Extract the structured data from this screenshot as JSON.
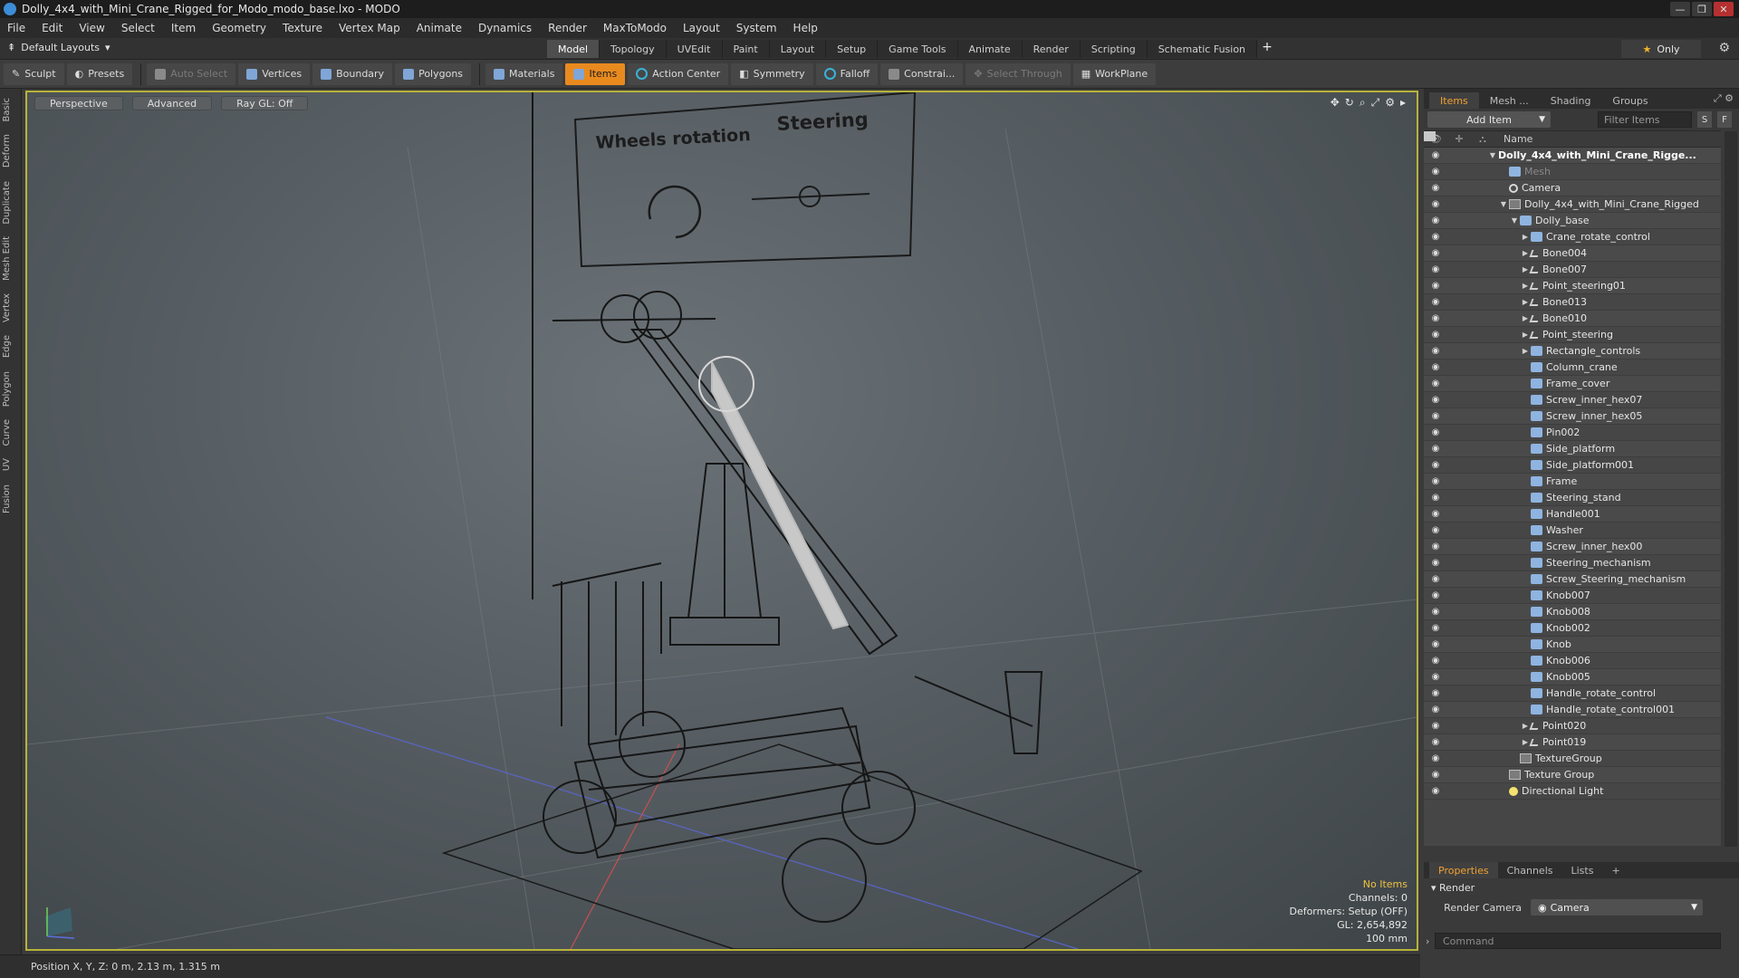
{
  "window": {
    "title": "Dolly_4x4_with_Mini_Crane_Rigged_for_Modo_modo_base.lxo - MODO",
    "buttons": [
      "—",
      "❐",
      "✕"
    ]
  },
  "menu": [
    "File",
    "Edit",
    "View",
    "Select",
    "Item",
    "Geometry",
    "Texture",
    "Vertex Map",
    "Animate",
    "Dynamics",
    "Render",
    "MaxToModo",
    "Layout",
    "System",
    "Help"
  ],
  "layouts": {
    "dropdown": "Default Layouts",
    "tabs": [
      "Model",
      "Topology",
      "UVEdit",
      "Paint",
      "Layout",
      "Setup",
      "Game Tools",
      "Animate",
      "Render",
      "Scripting",
      "Schematic Fusion"
    ],
    "active_tab": "Model",
    "plus": "+",
    "only_label": "Only"
  },
  "toolbar": {
    "sculpt": "Sculpt",
    "presets": "Presets",
    "auto_select": "Auto Select",
    "vertices": "Vertices",
    "boundary": "Boundary",
    "polygons": "Polygons",
    "materials": "Materials",
    "items": "Items",
    "action_center": "Action Center",
    "symmetry": "Symmetry",
    "falloff": "Falloff",
    "constrain": "Constrai...",
    "select_through": "Select Through",
    "workplane": "WorkPlane"
  },
  "left_tabs": [
    "Basic",
    "Deform",
    "Duplicate",
    "Mesh Edit",
    "Vertex",
    "Edge",
    "Polygon",
    "Curve",
    "UV",
    "Fusion"
  ],
  "viewport": {
    "view_mode": "Perspective",
    "shading": "Advanced",
    "raygl": "Ray GL: Off",
    "control_labels": [
      "Wheels rotation",
      "Steering"
    ],
    "info": {
      "selection": "No Items",
      "channels": "Channels: 0",
      "deformers": "Deformers: Setup (OFF)",
      "gl": "GL: 2,654,892",
      "grid": "100 mm"
    }
  },
  "items_panel": {
    "tabs": [
      "Items",
      "Mesh ...",
      "Shading",
      "Groups"
    ],
    "active_tab": "Items",
    "add_item": "Add Item",
    "filter_placeholder": "Filter Items",
    "s_btn": "S",
    "f_btn": "F",
    "column_name": "Name",
    "rows": [
      {
        "label": "Dolly_4x4_with_Mini_Crane_Rigge...",
        "icon": "scene",
        "depth": 0,
        "expander": "▼",
        "style": "bold"
      },
      {
        "label": "Mesh",
        "icon": "mesh",
        "depth": 1,
        "expander": "",
        "style": "dim"
      },
      {
        "label": "Camera",
        "icon": "cam",
        "depth": 1,
        "expander": "",
        "style": ""
      },
      {
        "label": "Dolly_4x4_with_Mini_Crane_Rigged",
        "icon": "group",
        "depth": 1,
        "expander": "▼",
        "style": ""
      },
      {
        "label": "Dolly_base",
        "icon": "mesh",
        "depth": 2,
        "expander": "▼",
        "style": ""
      },
      {
        "label": "Crane_rotate_control",
        "icon": "mesh",
        "depth": 3,
        "expander": "▶",
        "style": ""
      },
      {
        "label": "Bone004",
        "icon": "bone",
        "depth": 3,
        "expander": "▶",
        "style": ""
      },
      {
        "label": "Bone007",
        "icon": "bone",
        "depth": 3,
        "expander": "▶",
        "style": ""
      },
      {
        "label": "Point_steering01",
        "icon": "bone",
        "depth": 3,
        "expander": "▶",
        "style": ""
      },
      {
        "label": "Bone013",
        "icon": "bone",
        "depth": 3,
        "expander": "▶",
        "style": ""
      },
      {
        "label": "Bone010",
        "icon": "bone",
        "depth": 3,
        "expander": "▶",
        "style": ""
      },
      {
        "label": "Point_steering",
        "icon": "bone",
        "depth": 3,
        "expander": "▶",
        "style": ""
      },
      {
        "label": "Rectangle_controls",
        "icon": "mesh",
        "depth": 3,
        "expander": "▶",
        "style": ""
      },
      {
        "label": "Column_crane",
        "icon": "mesh",
        "depth": 3,
        "expander": "",
        "style": ""
      },
      {
        "label": "Frame_cover",
        "icon": "mesh",
        "depth": 3,
        "expander": "",
        "style": ""
      },
      {
        "label": "Screw_inner_hex07",
        "icon": "mesh",
        "depth": 3,
        "expander": "",
        "style": ""
      },
      {
        "label": "Screw_inner_hex05",
        "icon": "mesh",
        "depth": 3,
        "expander": "",
        "style": ""
      },
      {
        "label": "Pin002",
        "icon": "mesh",
        "depth": 3,
        "expander": "",
        "style": ""
      },
      {
        "label": "Side_platform",
        "icon": "mesh",
        "depth": 3,
        "expander": "",
        "style": ""
      },
      {
        "label": "Side_platform001",
        "icon": "mesh",
        "depth": 3,
        "expander": "",
        "style": ""
      },
      {
        "label": "Frame",
        "icon": "mesh",
        "depth": 3,
        "expander": "",
        "style": ""
      },
      {
        "label": "Steering_stand",
        "icon": "mesh",
        "depth": 3,
        "expander": "",
        "style": ""
      },
      {
        "label": "Handle001",
        "icon": "mesh",
        "depth": 3,
        "expander": "",
        "style": ""
      },
      {
        "label": "Washer",
        "icon": "mesh",
        "depth": 3,
        "expander": "",
        "style": ""
      },
      {
        "label": "Screw_inner_hex00",
        "icon": "mesh",
        "depth": 3,
        "expander": "",
        "style": ""
      },
      {
        "label": "Steering_mechanism",
        "icon": "mesh",
        "depth": 3,
        "expander": "",
        "style": ""
      },
      {
        "label": "Screw_Steering_mechanism",
        "icon": "mesh",
        "depth": 3,
        "expander": "",
        "style": ""
      },
      {
        "label": "Knob007",
        "icon": "mesh",
        "depth": 3,
        "expander": "",
        "style": ""
      },
      {
        "label": "Knob008",
        "icon": "mesh",
        "depth": 3,
        "expander": "",
        "style": ""
      },
      {
        "label": "Knob002",
        "icon": "mesh",
        "depth": 3,
        "expander": "",
        "style": ""
      },
      {
        "label": "Knob",
        "icon": "mesh",
        "depth": 3,
        "expander": "",
        "style": ""
      },
      {
        "label": "Knob006",
        "icon": "mesh",
        "depth": 3,
        "expander": "",
        "style": ""
      },
      {
        "label": "Knob005",
        "icon": "mesh",
        "depth": 3,
        "expander": "",
        "style": ""
      },
      {
        "label": "Handle_rotate_control",
        "icon": "mesh",
        "depth": 3,
        "expander": "",
        "style": ""
      },
      {
        "label": "Handle_rotate_control001",
        "icon": "mesh",
        "depth": 3,
        "expander": "",
        "style": ""
      },
      {
        "label": "Point020",
        "icon": "bone",
        "depth": 3,
        "expander": "▶",
        "style": ""
      },
      {
        "label": "Point019",
        "icon": "bone",
        "depth": 3,
        "expander": "▶",
        "style": ""
      },
      {
        "label": "TextureGroup",
        "icon": "group",
        "depth": 2,
        "expander": "",
        "style": ""
      },
      {
        "label": "Texture Group",
        "icon": "group",
        "depth": 1,
        "expander": "",
        "style": ""
      },
      {
        "label": "Directional Light",
        "icon": "light",
        "depth": 1,
        "expander": "",
        "style": ""
      }
    ]
  },
  "properties": {
    "tabs": [
      "Properties",
      "Channels",
      "Lists",
      "+"
    ],
    "active_tab": "Properties",
    "section": "Render",
    "render_camera_label": "Render Camera",
    "render_camera_value": "Camera",
    "command_placeholder": "Command",
    "more_btn": ">>"
  },
  "status": {
    "position": "Position X, Y, Z:  0 m, 2.13 m, 1.315 m"
  },
  "colors": {
    "accent": "#e98a1f",
    "viewport_border": "#b8b33a",
    "selection_info": "#f0c040"
  }
}
